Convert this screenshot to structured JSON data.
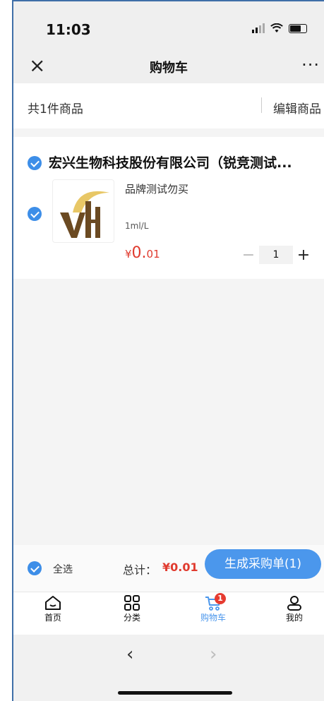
{
  "status_bar": {
    "time": "11:03"
  },
  "nav": {
    "title": "购物车"
  },
  "cart_summary": {
    "count_text": "共1件商品",
    "edit_label": "编辑商品"
  },
  "shop": {
    "name": "宏兴生物科技股份有限公司（锐竞测试...",
    "items": [
      {
        "name": "品牌测试勿买",
        "spec": "1ml/L",
        "price_currency": "¥",
        "price_main": "0.",
        "price_cents": "01",
        "quantity": "1",
        "checked": true
      }
    ]
  },
  "checkout": {
    "select_all_label": "全选",
    "total_label": "总计：",
    "total_value": "¥0.01",
    "submit_label": "生成采购单(1)"
  },
  "tabs": [
    {
      "label": "首页",
      "icon": "home-icon"
    },
    {
      "label": "分类",
      "icon": "category-icon"
    },
    {
      "label": "购物车",
      "icon": "cart-icon",
      "badge": "1",
      "active": true
    },
    {
      "label": "我的",
      "icon": "user-icon"
    }
  ],
  "colors": {
    "accent": "#4b97ec",
    "price": "#e03a2e",
    "badge": "#e63b30",
    "logo_gold": "#e8c766",
    "logo_brown": "#6b4a22"
  }
}
